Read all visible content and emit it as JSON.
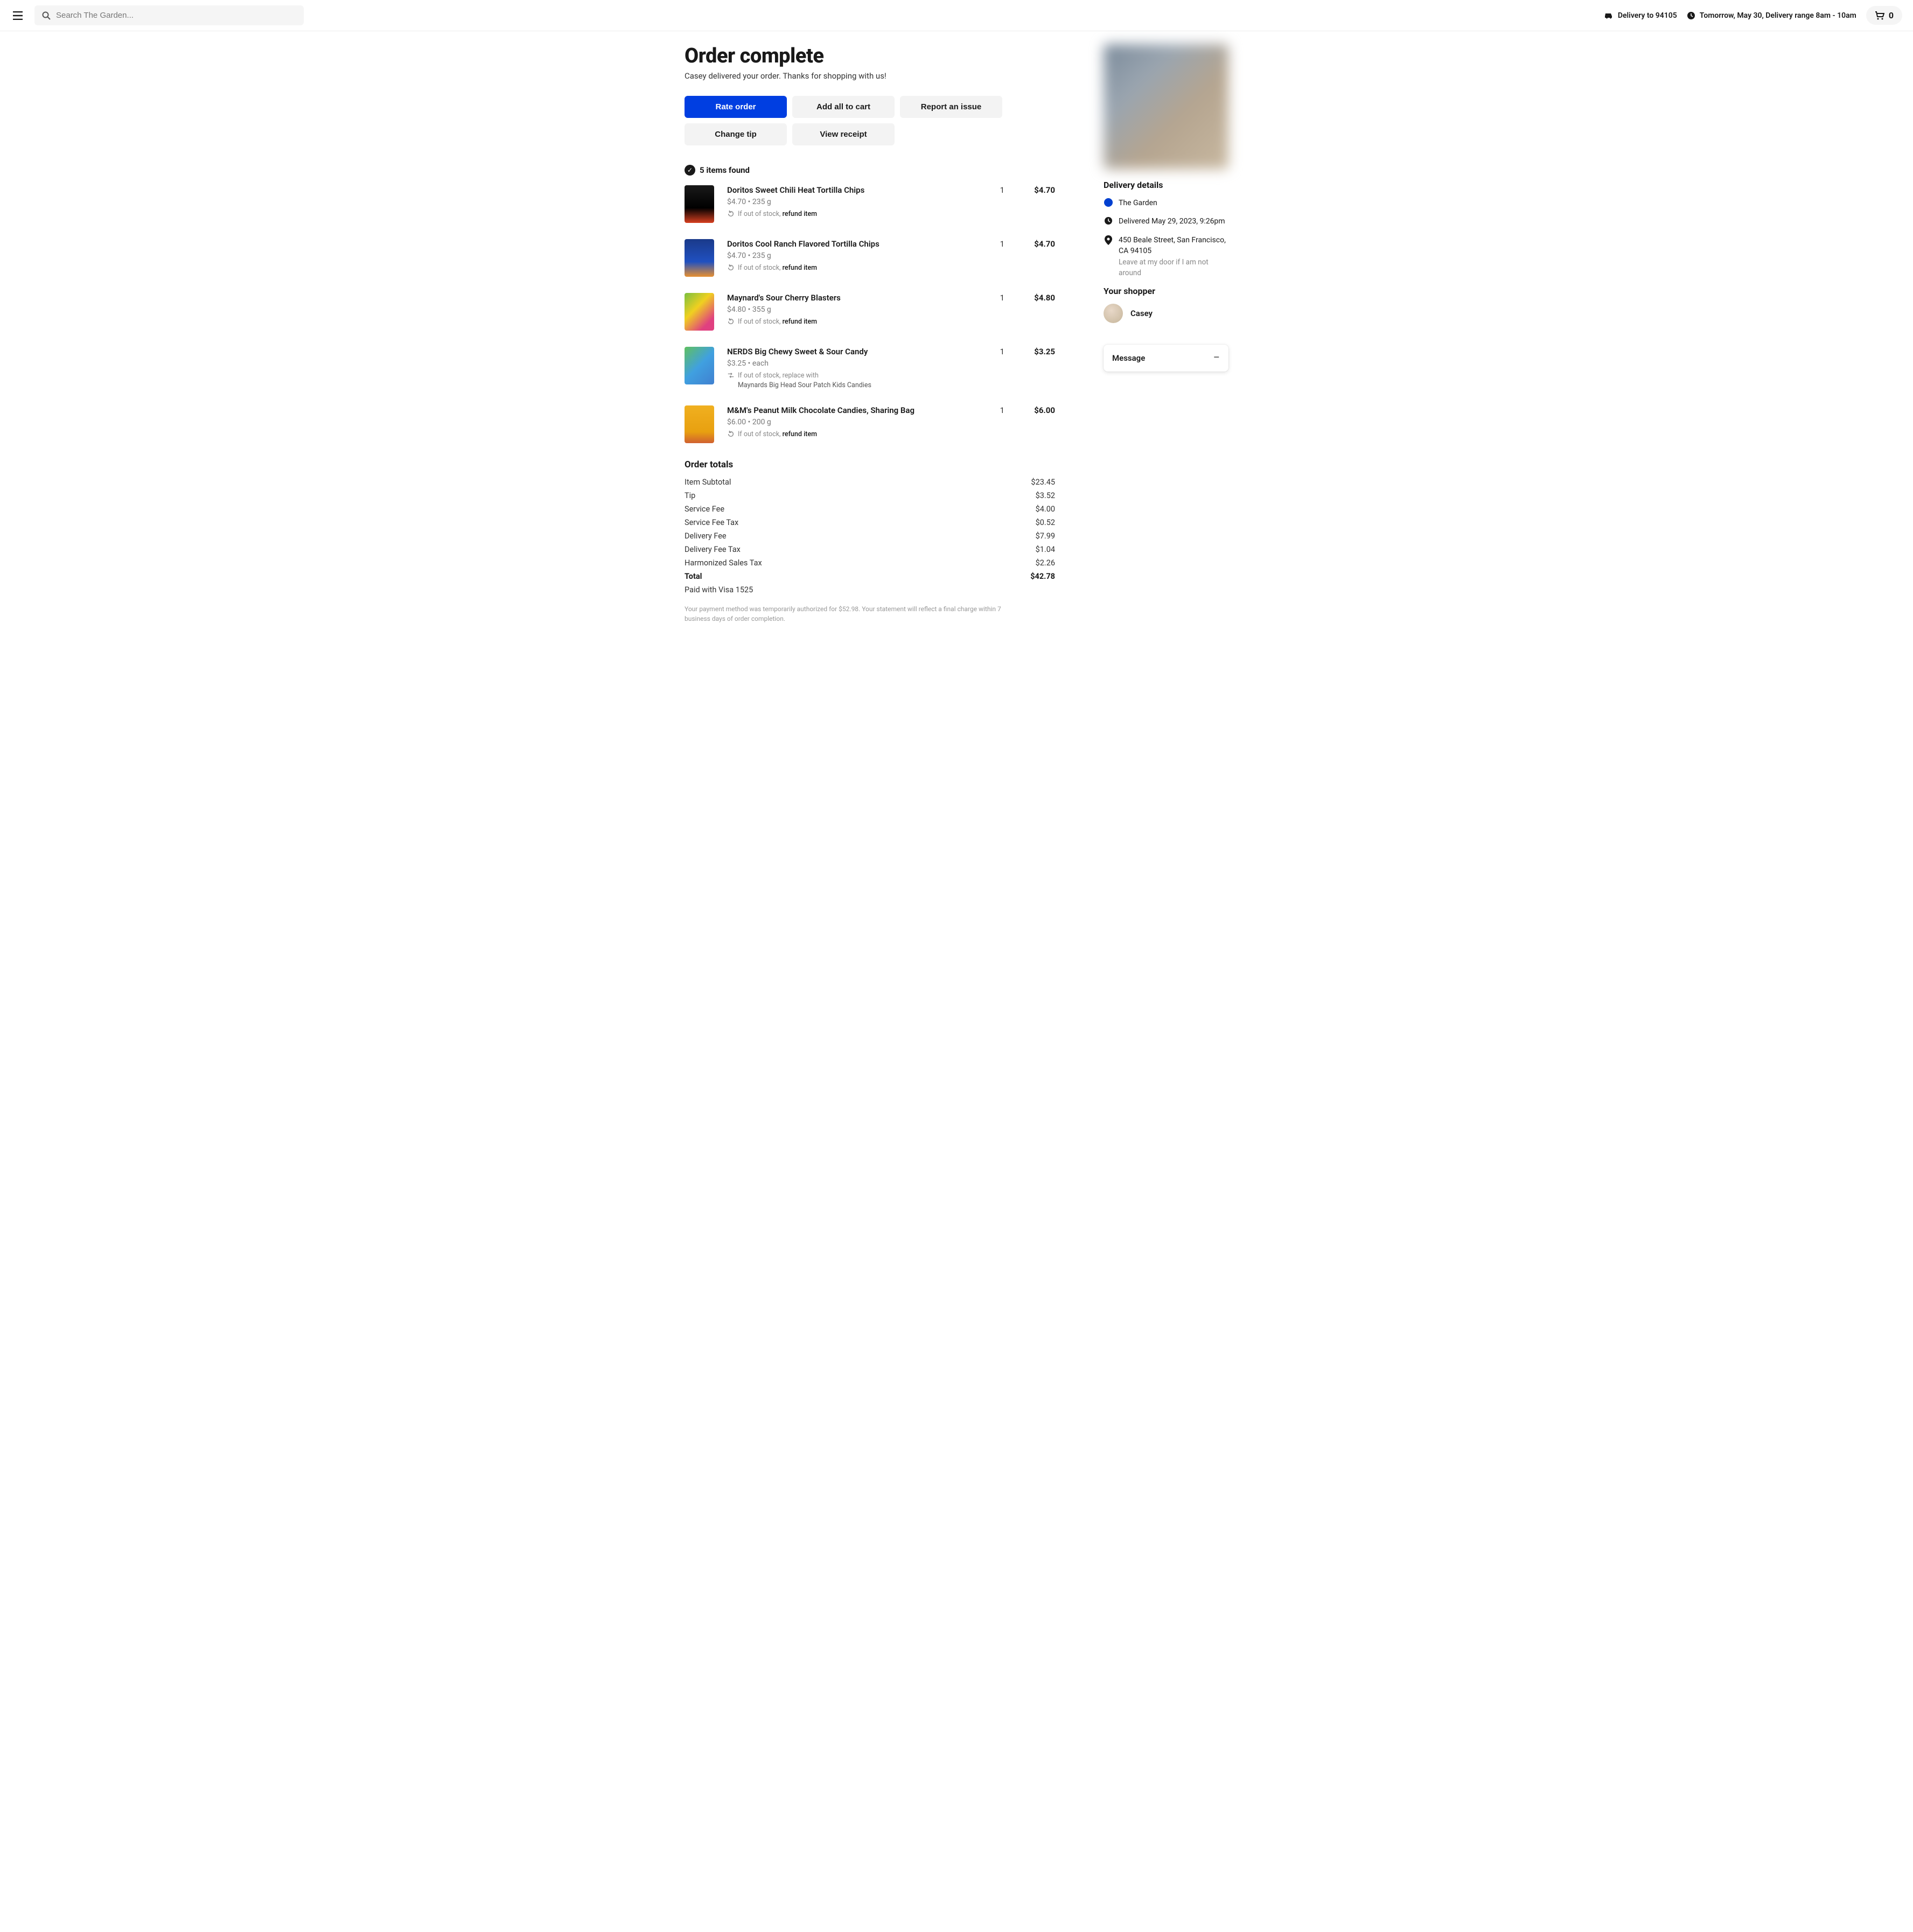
{
  "header": {
    "search_placeholder": "Search The Garden...",
    "delivery_to": "Delivery to 94105",
    "delivery_time": "Tomorrow, May 30, Delivery range 8am - 10am",
    "cart_count": "0"
  },
  "page": {
    "title": "Order complete",
    "subtitle": "Casey delivered your order. Thanks for shopping with us!"
  },
  "buttons": {
    "rate_order": "Rate order",
    "add_all_to_cart": "Add all to cart",
    "report_issue": "Report an issue",
    "change_tip": "Change tip",
    "view_receipt": "View receipt"
  },
  "items_found": "5 items found",
  "items": [
    {
      "name": "Doritos Sweet Chili Heat Tortilla Chips",
      "sub": "$4.70 • 235 g",
      "note_prefix": "If out of stock, ",
      "note_action": "refund item",
      "qty": "1",
      "price": "$4.70",
      "bg": "linear-gradient(180deg,#1a1a1a 0%,#000 60%,#d84020 100%)"
    },
    {
      "name": "Doritos Cool Ranch Flavored Tortilla Chips",
      "sub": "$4.70 • 235 g",
      "note_prefix": "If out of stock, ",
      "note_action": "refund item",
      "qty": "1",
      "price": "$4.70",
      "bg": "linear-gradient(180deg,#1a3a8a 0%,#2050c0 60%,#e89030 100%)"
    },
    {
      "name": "Maynard's Sour Cherry Blasters",
      "sub": "$4.80 • 355 g",
      "note_prefix": "If out of stock, ",
      "note_action": "refund item",
      "qty": "1",
      "price": "$4.80",
      "bg": "linear-gradient(135deg,#7ac040 0%,#f0d020 40%,#e04080 80%)"
    },
    {
      "name": "NERDS Big Chewy Sweet & Sour Candy",
      "sub": "$3.25 • each",
      "note_prefix": "If out of stock, replace with",
      "note_action": "",
      "note_sub": "Maynards Big Head Sour Patch Kids Candies",
      "replace": true,
      "qty": "1",
      "price": "$3.25",
      "bg": "linear-gradient(135deg,#60c060 0%,#40a0e0 50%,#4080d0 100%)"
    },
    {
      "name": "M&M's Peanut Milk Chocolate Candies, Sharing Bag",
      "sub": "$6.00 • 200 g",
      "note_prefix": "If out of stock, ",
      "note_action": "refund item",
      "qty": "1",
      "price": "$6.00",
      "bg": "linear-gradient(180deg,#f0b020 0%,#e8a010 70%,#d06030 100%)"
    }
  ],
  "totals": {
    "heading": "Order totals",
    "rows": [
      {
        "label": "Item Subtotal",
        "value": "$23.45"
      },
      {
        "label": "Tip",
        "value": "$3.52"
      },
      {
        "label": "Service Fee",
        "value": "$4.00"
      },
      {
        "label": "Service Fee Tax",
        "value": "$0.52"
      },
      {
        "label": "Delivery Fee",
        "value": "$7.99"
      },
      {
        "label": "Delivery Fee Tax",
        "value": "$1.04"
      },
      {
        "label": "Harmonized Sales Tax",
        "value": "$2.26"
      }
    ],
    "grand_label": "Total",
    "grand_value": "$42.78",
    "paid_with": "Paid with Visa 1525",
    "disclaimer": "Your payment method was temporarily authorized for $52.98. Your statement will reflect a final charge within 7 business days of order completion."
  },
  "delivery": {
    "heading": "Delivery details",
    "store": "The Garden",
    "delivered": "Delivered May 29, 2023, 9:26pm",
    "address": "450 Beale Street, San Francisco, CA 94105",
    "address_note": "Leave at my door if I am not around"
  },
  "shopper": {
    "heading": "Your shopper",
    "name": "Casey"
  },
  "message": {
    "label": "Message"
  }
}
